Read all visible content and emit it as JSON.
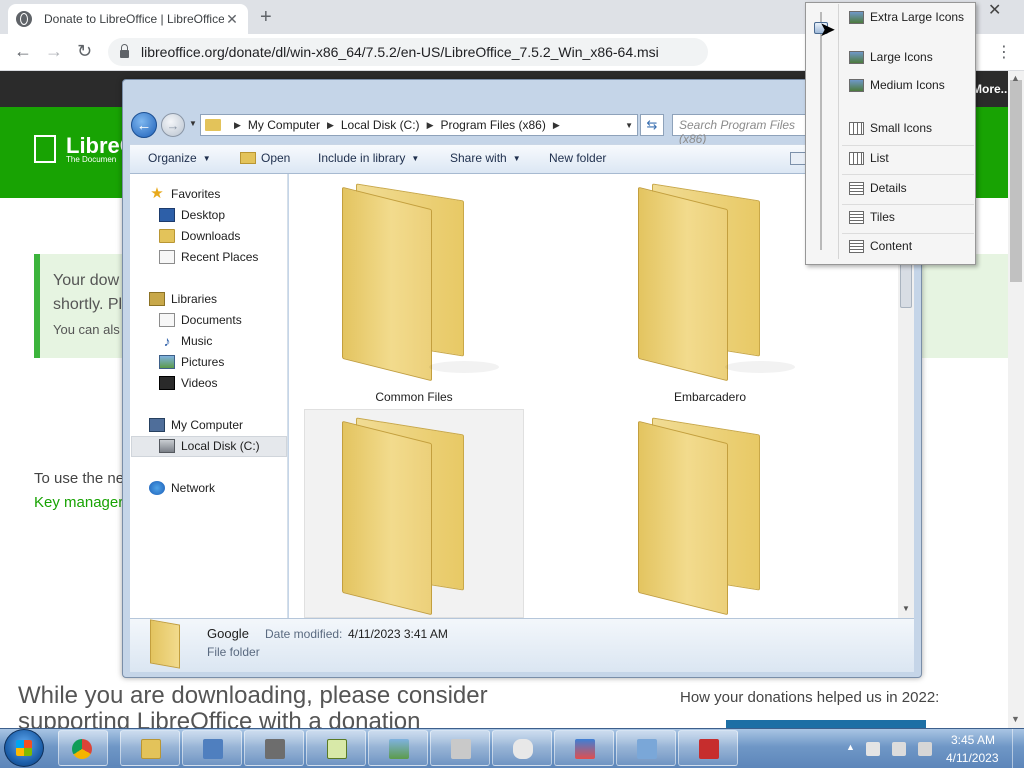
{
  "browser": {
    "tab_title": "Donate to LibreOffice | LibreOffice",
    "tab_close": "✕",
    "new_tab": "+",
    "window_close": "✕",
    "url": "libreoffice.org/donate/dl/win-x86_64/7.5.2/en-US/LibreOffice_7.5.2_Win_x86-64.msi",
    "back": "←",
    "forward": "→",
    "reload": "↻",
    "menu": "⋮"
  },
  "webpage": {
    "more_label": "More...",
    "logo_name": "LibreO",
    "logo_tagline": "The Documen",
    "notice_line1": "Your dow",
    "notice_line2": "shortly. Pl",
    "notice_line3": "You can als",
    "key_line1": "To use the ne",
    "key_line2": "Key manager",
    "donate_heading": "While you are downloading, please consider supporting LibreOffice with a donation",
    "donations_helped": "How your donations helped us in 2022:",
    "accent_green": "#18a303"
  },
  "explorer": {
    "breadcrumb": [
      "My Computer",
      "Local Disk (C:)",
      "Program Files (x86)"
    ],
    "search_placeholder": "Search Program Files (x86)",
    "commands": {
      "organize": "Organize",
      "open": "Open",
      "include_in_library": "Include in library",
      "share_with": "Share with",
      "new_folder": "New folder"
    },
    "nav": {
      "favorites": "Favorites",
      "desktop": "Desktop",
      "downloads": "Downloads",
      "recent_places": "Recent Places",
      "libraries": "Libraries",
      "documents": "Documents",
      "music": "Music",
      "pictures": "Pictures",
      "videos": "Videos",
      "my_computer": "My Computer",
      "local_disk": "Local Disk (C:)",
      "network": "Network"
    },
    "folders": [
      "Common Files",
      "Embarcadero",
      "",
      ""
    ],
    "details": {
      "name": "Google",
      "date_label": "Date modified:",
      "date_value": "4/11/2023 3:41 AM",
      "type": "File folder"
    }
  },
  "view_menu": {
    "items": [
      "Extra Large Icons",
      "Large Icons",
      "Medium Icons",
      "Small Icons",
      "List",
      "Details",
      "Tiles",
      "Content"
    ],
    "selected_level": "Extra Large Icons"
  },
  "taskbar": {
    "time": "3:45 AM",
    "date": "4/11/2023",
    "tray_up": "▲",
    "apps": [
      "chrome-icon",
      "explorer-icon",
      "control-panel-icon",
      "computer-icon",
      "notepad-icon",
      "picture-viewer-icon",
      "printer-icon",
      "mouse-icon",
      "display-icon",
      "remote-desktop-icon",
      "toolbox-icon"
    ]
  }
}
